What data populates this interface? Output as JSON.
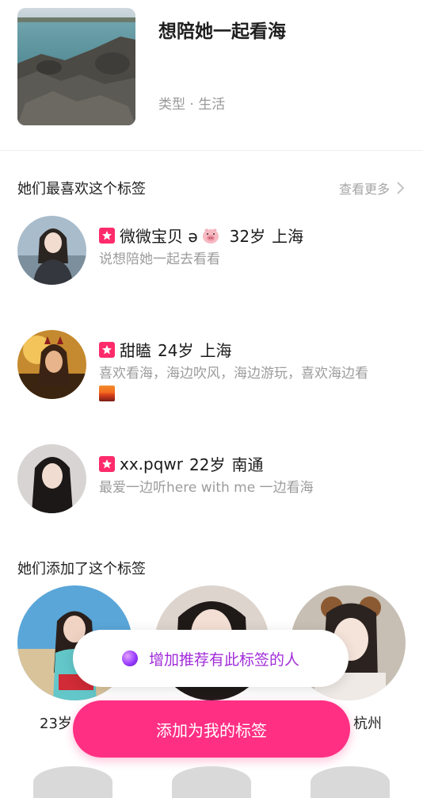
{
  "tag": {
    "title": "想陪她一起看海",
    "type": "类型 · 生活"
  },
  "favorites_section": {
    "title": "她们最喜欢这个标签",
    "see_more": "查看更多"
  },
  "users": [
    {
      "name": "微微宝贝 ə",
      "age": "32岁",
      "city": "上海",
      "desc": "说想陪她一起去看看"
    },
    {
      "name": "甜瞌",
      "age": "24岁",
      "city": "上海",
      "desc": "喜欢看海，海边吹风，海边游玩，喜欢海边看"
    },
    {
      "name": "xx.pqwr",
      "age": "22岁",
      "city": "南通",
      "desc": "最爱一边听here with me 一边看海"
    }
  ],
  "added_section": {
    "title": "她们添加了这个标签"
  },
  "added_users": [
    {
      "meta": "23岁"
    },
    {
      "meta": ""
    },
    {
      "meta": "杭州"
    }
  ],
  "buttons": {
    "recommend": "增加推荐有此标签的人",
    "add": "添加为我的标签"
  },
  "colors": {
    "accent": "#ff2f84",
    "badge": "#ff2b6a",
    "recommend_text": "#a12cd9"
  },
  "icons": [
    "star-badge-icon",
    "pig-emoji-icon",
    "sunset-emoji-icon",
    "chevron-right-icon",
    "sparkle-orb-icon"
  ]
}
